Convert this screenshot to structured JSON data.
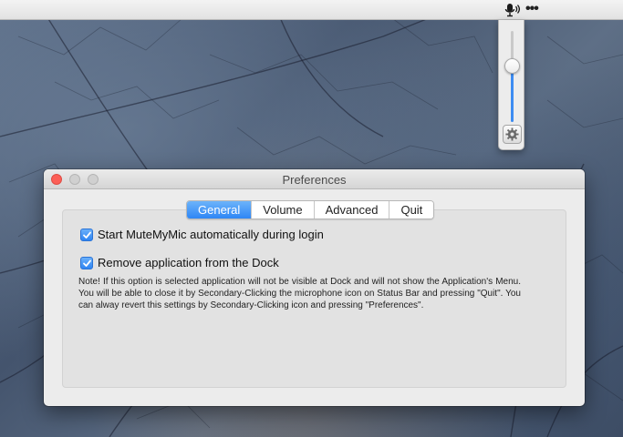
{
  "menubar": {
    "status_icon": "microphone-volume-icon",
    "more_icon": "ellipsis-icon",
    "more_label": "•••"
  },
  "volume_popup": {
    "level_percent": 62,
    "settings_icon": "gear-icon"
  },
  "window": {
    "title": "Preferences",
    "tabs": [
      {
        "label": "General",
        "active": true
      },
      {
        "label": "Volume",
        "active": false
      },
      {
        "label": "Advanced",
        "active": false
      },
      {
        "label": "Quit",
        "active": false
      }
    ],
    "general": {
      "start_at_login": {
        "label": "Start MuteMyMic automatically during login",
        "checked": true
      },
      "remove_from_dock": {
        "label": "Remove application from the Dock",
        "checked": true
      },
      "note": "Note! If this option is selected application will not be visible at Dock and will not show the Application's Menu. You will be able to close it by Secondary-Clicking the microphone icon on Status Bar and pressing \"Quit\". You can alway revert this settings by Secondary-Clicking icon and pressing \"Preferences\"."
    }
  },
  "colors": {
    "accent": "#2e86f5",
    "close_button": "#fc5f57"
  }
}
